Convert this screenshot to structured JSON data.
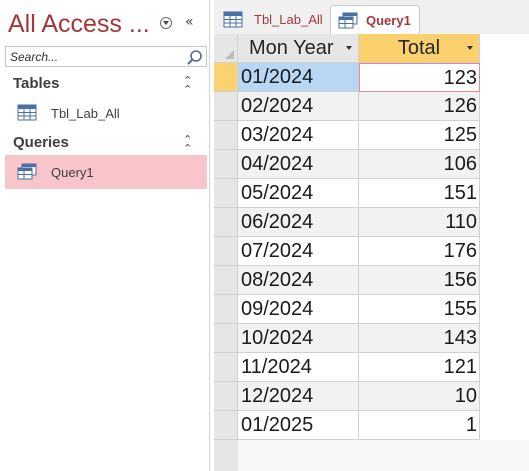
{
  "nav": {
    "title": "All Access ...",
    "search_placeholder": "Search...",
    "groups": [
      {
        "label": "Tables",
        "items": [
          {
            "label": "Tbl_Lab_All",
            "icon": "table-icon"
          }
        ]
      },
      {
        "label": "Queries",
        "items": [
          {
            "label": "Query1",
            "icon": "query-icon",
            "selected": true
          }
        ]
      }
    ]
  },
  "tabs": [
    {
      "label": "Tbl_Lab_All",
      "icon": "table-icon",
      "active": false
    },
    {
      "label": "Query1",
      "icon": "query-icon",
      "active": true
    }
  ],
  "datasheet": {
    "columns": [
      "Mon Year",
      "Total"
    ],
    "rows": [
      {
        "mon_year": "01/2024",
        "total": "123"
      },
      {
        "mon_year": "02/2024",
        "total": "126"
      },
      {
        "mon_year": "03/2024",
        "total": "125"
      },
      {
        "mon_year": "04/2024",
        "total": "106"
      },
      {
        "mon_year": "05/2024",
        "total": "151"
      },
      {
        "mon_year": "06/2024",
        "total": "110"
      },
      {
        "mon_year": "07/2024",
        "total": "176"
      },
      {
        "mon_year": "08/2024",
        "total": "156"
      },
      {
        "mon_year": "09/2024",
        "total": "155"
      },
      {
        "mon_year": "10/2024",
        "total": "143"
      },
      {
        "mon_year": "11/2024",
        "total": "121"
      },
      {
        "mon_year": "12/2024",
        "total": "10"
      },
      {
        "mon_year": "01/2025",
        "total": "1"
      }
    ]
  },
  "colors": {
    "accent": "#a4373a",
    "selected_nav_item": "#f8c6ca",
    "sorted_column_header": "#fbd16e",
    "current_record_selector": "#fad271",
    "selected_cell": "#b7d7f4"
  }
}
